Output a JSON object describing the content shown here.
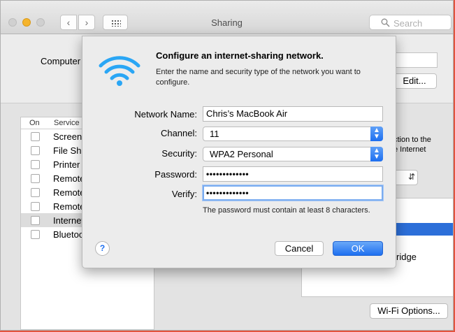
{
  "window": {
    "title": "Sharing",
    "search_placeholder": "Search",
    "computer_name_label": "Computer",
    "edit_button": "Edit...",
    "service_list": {
      "header_on": "On",
      "header_service": "Service",
      "items": [
        {
          "label": "Screen",
          "checked": false,
          "selected": false
        },
        {
          "label": "File Sha",
          "checked": false,
          "selected": false
        },
        {
          "label": "Printer",
          "checked": false,
          "selected": false
        },
        {
          "label": "Remote",
          "checked": false,
          "selected": false
        },
        {
          "label": "Remote",
          "checked": false,
          "selected": false
        },
        {
          "label": "Remote",
          "checked": false,
          "selected": false
        },
        {
          "label": "Internet",
          "checked": false,
          "selected": true
        },
        {
          "label": "Bluetoo",
          "checked": false,
          "selected": false
        }
      ]
    },
    "right_text_1": "ction to the",
    "right_text_2": "e Internet",
    "bridge_text": "ridge",
    "wifi_options_button": "Wi-Fi Options..."
  },
  "sheet": {
    "title": "Configure an internet-sharing network.",
    "description": "Enter the name and security type of the network you want to configure.",
    "network_name_label": "Network Name:",
    "network_name_value": "Chris’s MacBook Air",
    "channel_label": "Channel:",
    "channel_value": "11",
    "security_label": "Security:",
    "security_value": "WPA2 Personal",
    "password_label": "Password:",
    "password_value": "•••••••••••••",
    "verify_label": "Verify:",
    "verify_value": "•••••••••••••",
    "hint": "The password must contain at least 8 characters.",
    "help_button": "?",
    "cancel_button": "Cancel",
    "ok_button": "OK"
  },
  "colors": {
    "accent_blue": "#1e6ff0",
    "wifi_icon": "#2aa6f5",
    "desktop": "#e2543f"
  }
}
